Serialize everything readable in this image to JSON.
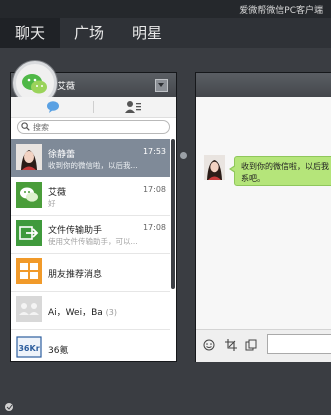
{
  "window": {
    "title": "爱微帮微信PC客户端"
  },
  "nav": {
    "tabs": [
      {
        "label": "聊天"
      },
      {
        "label": "广场"
      },
      {
        "label": "明星"
      }
    ]
  },
  "profile": {
    "name": "艾薇"
  },
  "search": {
    "placeholder": "搜索"
  },
  "chats": [
    {
      "name": "徐静蕾",
      "preview": "收到你的微信啦，以后我...",
      "time": "17:53"
    },
    {
      "name": "艾薇",
      "preview": "好",
      "time": "17:08"
    },
    {
      "name": "文件传输助手",
      "preview": "使用文件传输助手，可以...",
      "time": "17:08"
    },
    {
      "name": "朋友推荐消息",
      "preview": "",
      "time": ""
    },
    {
      "name": "Ai，Wei，Ba",
      "count": "(3)",
      "preview": "",
      "time": ""
    },
    {
      "name": "36氪",
      "preview": "",
      "time": ""
    }
  ],
  "avatar_labels": {
    "36kr": "36Kr"
  },
  "conversation": {
    "message": "收到你的微信啦，以后我会尽快联系吧。",
    "message_lines": [
      "收到你的微信啦，以后我",
      "系吧。"
    ]
  },
  "icons": {
    "chat_tab": "chat-bubble-icon",
    "contacts_tab": "contacts-icon",
    "search": "search-icon",
    "emoji": "emoji-icon",
    "screenshot": "screenshot-icon",
    "files": "files-icon",
    "dropdown": "chevron-down-icon"
  },
  "colors": {
    "titlebar": "#25282c",
    "navbar": "#2f3237",
    "selected_item": "#7f8a98",
    "bubble": "#b5e57a",
    "accent_blue": "#5aa1e3"
  }
}
